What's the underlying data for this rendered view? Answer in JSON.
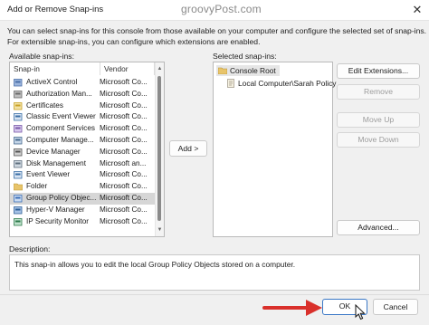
{
  "window": {
    "title": "Add or Remove Snap-ins",
    "close_glyph": "✕"
  },
  "watermark": "groovyPost.com",
  "intro": {
    "line1": "You can select snap-ins for this console from those available on your computer and configure the selected set of snap-ins.",
    "line2": "For extensible snap-ins, you can configure which extensions are enabled."
  },
  "available": {
    "label": "Available snap-ins:",
    "columns": [
      "Snap-in",
      "Vendor"
    ],
    "rows": [
      {
        "name": "ActiveX Control",
        "vendor": "Microsoft Co...",
        "icon": "activex-icon"
      },
      {
        "name": "Authorization Man...",
        "vendor": "Microsoft Co...",
        "icon": "authorization-icon"
      },
      {
        "name": "Certificates",
        "vendor": "Microsoft Co...",
        "icon": "certificate-icon"
      },
      {
        "name": "Classic Event Viewer",
        "vendor": "Microsoft Co...",
        "icon": "event-viewer-icon"
      },
      {
        "name": "Component Services",
        "vendor": "Microsoft Co...",
        "icon": "component-services-icon"
      },
      {
        "name": "Computer Manage...",
        "vendor": "Microsoft Co...",
        "icon": "computer-management-icon"
      },
      {
        "name": "Device Manager",
        "vendor": "Microsoft Co...",
        "icon": "device-manager-icon"
      },
      {
        "name": "Disk Management",
        "vendor": "Microsoft an...",
        "icon": "disk-icon"
      },
      {
        "name": "Event Viewer",
        "vendor": "Microsoft Co...",
        "icon": "event-viewer-icon"
      },
      {
        "name": "Folder",
        "vendor": "Microsoft Co...",
        "icon": "folder-icon"
      },
      {
        "name": "Group Policy Objec...",
        "vendor": "Microsoft Co...",
        "icon": "group-policy-icon"
      },
      {
        "name": "Hyper-V Manager",
        "vendor": "Microsoft Co...",
        "icon": "hyperv-icon"
      },
      {
        "name": "IP Security Monitor",
        "vendor": "Microsoft Co...",
        "icon": "ip-security-icon"
      }
    ],
    "selected_index": 10
  },
  "add_button": "Add >",
  "selected": {
    "label": "Selected snap-ins:",
    "root": "Console Root",
    "child": "Local Computer\\Sarah Policy"
  },
  "side_buttons": {
    "edit_extensions": "Edit Extensions...",
    "remove": "Remove",
    "move_up": "Move Up",
    "move_down": "Move Down",
    "advanced": "Advanced..."
  },
  "description": {
    "label": "Description:",
    "text": "This snap-in allows you to edit the local Group Policy Objects stored on a computer."
  },
  "footer": {
    "ok": "OK",
    "cancel": "Cancel"
  },
  "colors": {
    "accent": "#3b78c6",
    "annotation_arrow": "#d9302b",
    "selected_row": "#d6d6d6"
  }
}
